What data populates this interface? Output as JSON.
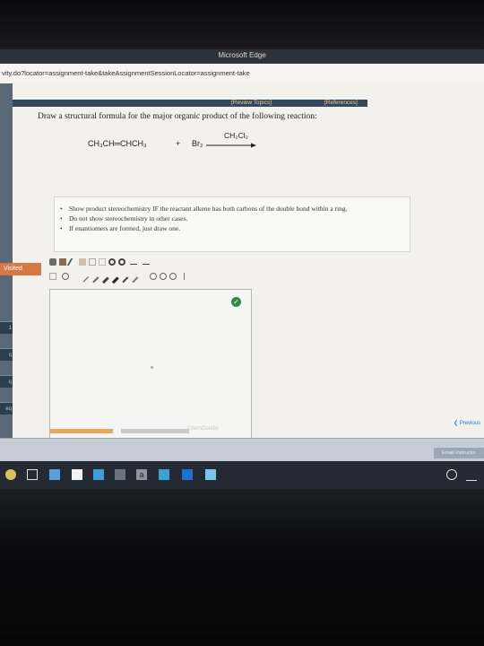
{
  "window": {
    "app_title": "Microsoft Edge",
    "url": "vity.do?locator=assignment-take&takeAssignmentSessionLocator=assignment-take"
  },
  "header": {
    "review_topics": "[Review Topics]",
    "references": "[References]"
  },
  "question": {
    "prompt": "Draw a structural formula for the major organic product of the following reaction:",
    "reactant1": "CH₃CH═CHCH₃",
    "plus": "+",
    "reactant2": "Br₂",
    "reagent": "CH₂Cl₂"
  },
  "instructions": [
    "Show product stereochemistry IF the reactant alkene has both carbons of the double bond within a ring.",
    "Do not show stereochemistry in other cases.",
    "If enantiomers are formed, just draw one."
  ],
  "sidebar": {
    "visited_label": "Visited",
    "tabs": [
      "1",
      "q",
      "q",
      "eq"
    ]
  },
  "editor": {
    "watermark": "ChemDoodle"
  },
  "nav": {
    "previous": "Previous",
    "email": "Email Instructor"
  },
  "colors": {
    "accent_orange": "#d57845",
    "topic_bar": "#34495e",
    "link": "#f0c98d"
  }
}
